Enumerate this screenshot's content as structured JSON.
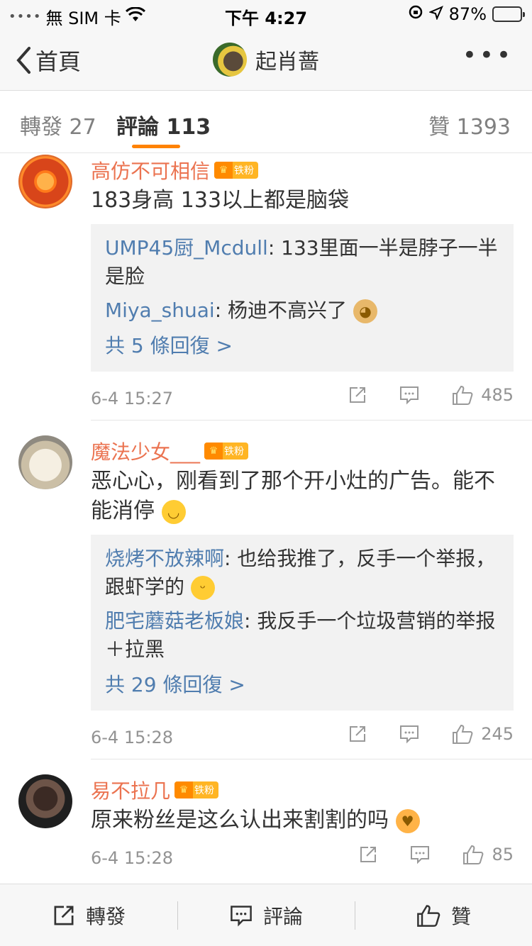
{
  "statusbar": {
    "carrier": "無 SIM 卡",
    "time": "下午 4:27",
    "battery": "87%"
  },
  "nav": {
    "back_label": "首頁",
    "user": "起肖蔷"
  },
  "tabs": {
    "repost": "轉發 27",
    "comments": "評論 113",
    "likes": "贊 1393"
  },
  "comments": [
    {
      "username": "高仿不可相信",
      "badge": "铁粉",
      "text": "183身高  133以上都是脑袋",
      "replies": [
        {
          "name": "UMP45厨_Mcdull",
          "text": ": 133里面一半是脖子一半是脸"
        },
        {
          "name": "Miya_shuai",
          "text": ": 杨迪不高兴了",
          "emoji": "doge"
        }
      ],
      "reply_more": "共 5 條回復 >",
      "time": "6-4 15:27",
      "likes": "485"
    },
    {
      "username": "魔法少女___",
      "badge": "铁粉",
      "text": "恶心心，刚看到了那个开小灶的广告。能不能消停",
      "emoji": "smile",
      "replies": [
        {
          "name": "烧烤不放辣啊",
          "text": ": 也给我推了，反手一个举报，跟虾学的",
          "emoji": "grin"
        },
        {
          "name": "肥宅蘑菇老板娘",
          "text": ": 我反手一个垃圾营销的举报＋拉黑"
        }
      ],
      "reply_more": "共 29 條回復 >",
      "time": "6-4 15:28",
      "likes": "245"
    },
    {
      "username": "易不拉几",
      "badge": "铁粉",
      "text": "原来粉丝是这么认出来割割的吗",
      "emoji": "blush",
      "time": "6-4 15:28",
      "likes": "85"
    }
  ],
  "bottombar": {
    "repost": "轉發",
    "comment": "評論",
    "like": "贊"
  }
}
